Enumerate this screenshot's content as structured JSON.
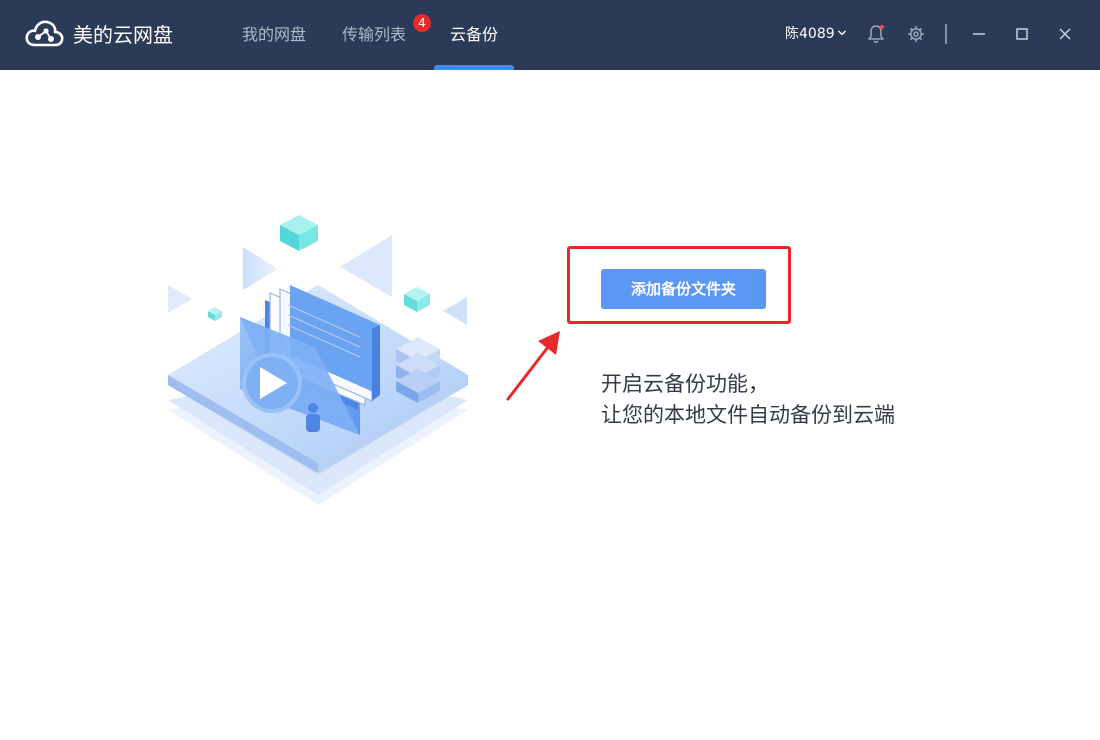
{
  "header": {
    "app_title": "美的云网盘",
    "tabs": [
      {
        "label": "我的网盘"
      },
      {
        "label": "传输列表",
        "badge": "4"
      },
      {
        "label": "云备份",
        "active": true
      }
    ],
    "user_name": "陈4089"
  },
  "icons": {
    "logo": "cloud-logo-icon",
    "dropdown": "chevron-down-icon",
    "notifications": "bell-icon",
    "settings": "gear-icon",
    "minimize": "minimize-icon",
    "maximize": "maximize-icon",
    "close": "close-icon"
  },
  "main": {
    "add_button_label": "添加备份文件夹",
    "description_line1": "开启云备份功能，",
    "description_line2": "让您的本地文件自动备份到云端"
  },
  "colors": {
    "titlebar": "#2b3a56",
    "accent": "#5b97f5",
    "highlight": "#e8292a",
    "badge": "#e8292a"
  }
}
